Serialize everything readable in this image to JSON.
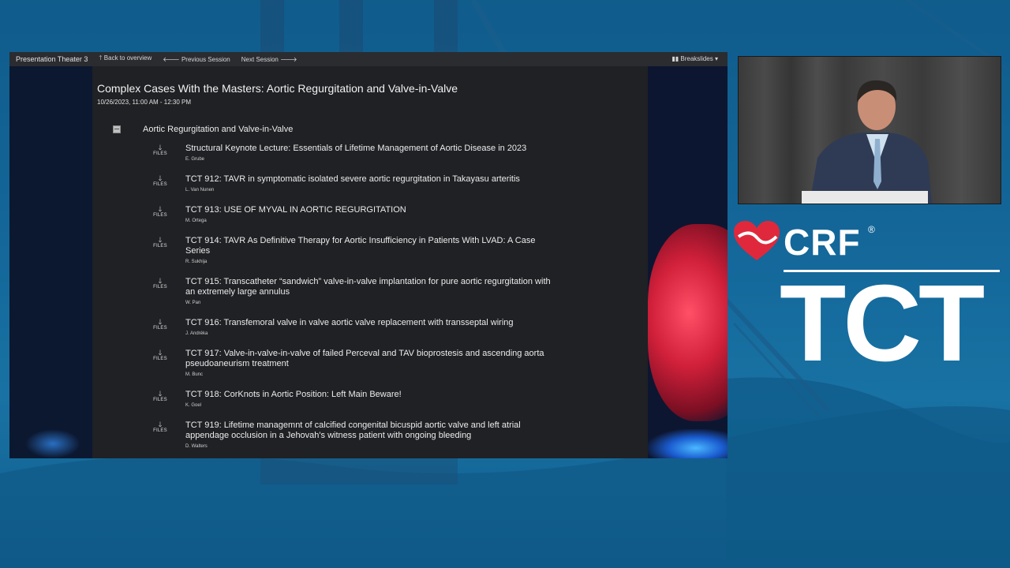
{
  "topbar": {
    "theater": "Presentation Theater 3",
    "back": "🡑 Back to overview",
    "previous": "🡐 Previous Session",
    "next": "Next Session 🡒",
    "breakslides": "▮▮ Breakslides ▾"
  },
  "session": {
    "title": "Complex Cases With the Masters: Aortic Regurgitation and Valve-in-Valve",
    "date": "10/26/2023, 11:00 AM - 12:30 PM",
    "group": "Aortic Regurgitation and Valve-in-Valve"
  },
  "files_label": "FILES",
  "files_arrow": "🡓",
  "talks": [
    {
      "title": "Structural Keynote Lecture: Essentials of Lifetime Management of Aortic Disease in 2023",
      "author": "E. Grube"
    },
    {
      "title": "TCT 912: TAVR in symptomatic isolated severe aortic regurgitation in Takayasu arteritis",
      "author": "L. Van Nunen"
    },
    {
      "title": "TCT 913: USE OF MYVAL IN AORTIC REGURGITATION",
      "author": "M. Ortega"
    },
    {
      "title": "TCT 914: TAVR As Definitive Therapy for Aortic Insufficiency in Patients With LVAD: A Case Series",
      "author": "R. Sukhija"
    },
    {
      "title": "TCT 915:  Transcatheter “sandwich” valve-in-valve implantation for pure aortic regurgitation with an extremely large annulus",
      "author": "W. Pan"
    },
    {
      "title": "TCT 916: Transfemoral valve in valve aortic valve replacement with transseptal wiring",
      "author": "J. Andréka"
    },
    {
      "title": "TCT 917: Valve-in-valve-in-valve of failed Perceval and TAV bioprostesis and ascending aorta pseudoaneurism treatment",
      "author": "M. Bunc"
    },
    {
      "title": "TCT 918: CorKnots in Aortic Position: Left Main Beware!",
      "author": "K. Goel"
    },
    {
      "title": "TCT 919: Lifetime managemnt of calcified congenital bicuspid aortic valve and left atrial appendage occlusion in a Jehovah's witness patient with ongoing bleeding",
      "author": "D. Walters"
    }
  ],
  "logo": {
    "crf": "CRF",
    "reg": "®",
    "tct": "TCT"
  },
  "colors": {
    "background": "#14699a",
    "panel": "#1f2124",
    "accent_red": "#e0283c"
  }
}
